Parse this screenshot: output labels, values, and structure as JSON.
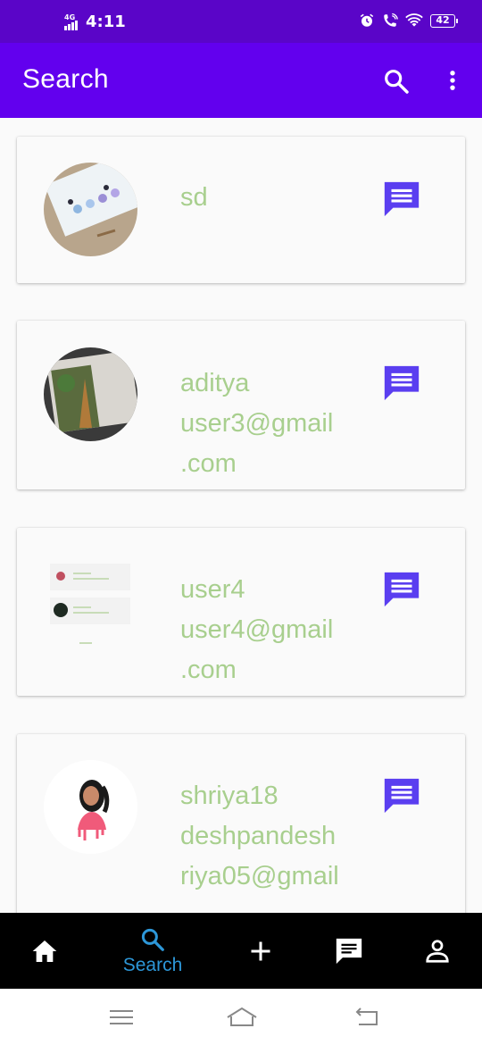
{
  "status_bar": {
    "network": "4G",
    "time": "4:11",
    "battery": "42",
    "icons": [
      "alarm-icon",
      "wifi-call-icon",
      "wifi-icon",
      "battery-icon"
    ]
  },
  "app_bar": {
    "title": "Search",
    "icons": [
      "search-icon",
      "more-vert-icon"
    ],
    "color": "#6200ee"
  },
  "results": [
    {
      "name": "sd",
      "email": "",
      "avatar": "card-photo"
    },
    {
      "name": "aditya",
      "email": "user3@gmail\n.com",
      "avatar": "tower-photo"
    },
    {
      "name": "user4",
      "email": "user4@gmail\n.com",
      "avatar": "screenshot-thumbnail"
    },
    {
      "name": "shriya18",
      "email": "deshpandesh\nriya05@gmail",
      "avatar": "portrait-photo"
    }
  ],
  "result_text_color": "#a8cf8e",
  "message_icon_color": "#5a3ef0",
  "bottom_nav": {
    "items": [
      {
        "icon": "home-icon",
        "label": ""
      },
      {
        "icon": "search-icon",
        "label": "Search",
        "active": true
      },
      {
        "icon": "add-icon",
        "label": ""
      },
      {
        "icon": "chat-icon",
        "label": ""
      },
      {
        "icon": "profile-icon",
        "label": ""
      }
    ],
    "active_color": "#2d97d8"
  },
  "system_nav": [
    "menu-icon",
    "home-outline-icon",
    "back-icon"
  ]
}
